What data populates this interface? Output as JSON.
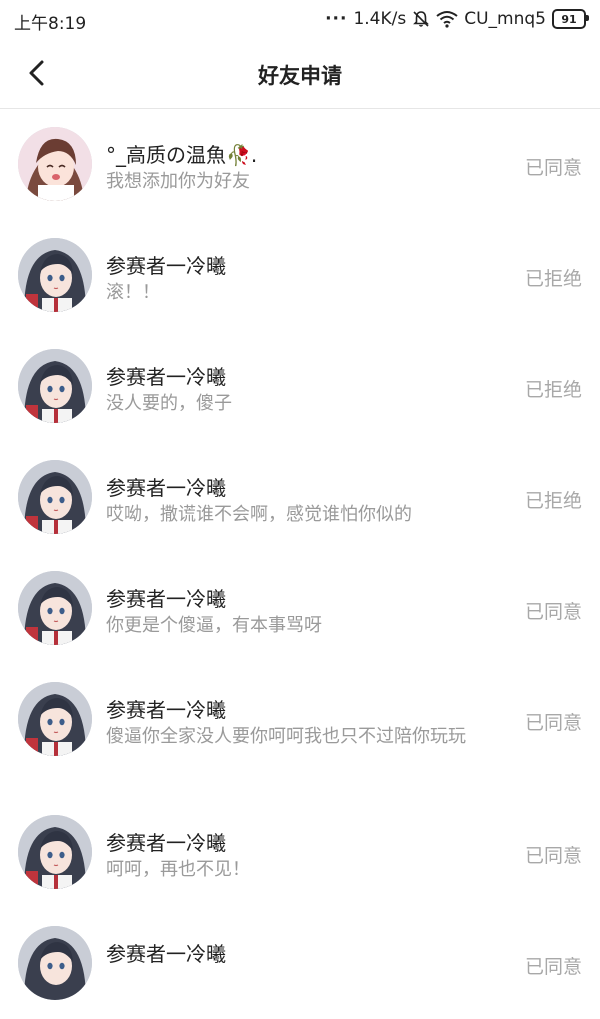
{
  "status_bar": {
    "time": "上午8:19",
    "net_speed": "1.4K/s",
    "carrier": "CU_mnq5",
    "battery": "91"
  },
  "nav": {
    "title": "好友申请"
  },
  "requests": [
    {
      "name": "°_高质の温魚🥀.",
      "message": "我想添加你为好友",
      "status": "已同意",
      "avatar": "girl-avatar-smiling"
    },
    {
      "name": "参赛者一冷曦",
      "message": "滚！！",
      "status": "已拒绝",
      "avatar": "girl-avatar-dark-hair"
    },
    {
      "name": "参赛者一冷曦",
      "message": "没人要的，傻子",
      "status": "已拒绝",
      "avatar": "girl-avatar-dark-hair"
    },
    {
      "name": "参赛者一冷曦",
      "message": "哎呦，撒谎谁不会啊，感觉谁怕你似的",
      "status": "已拒绝",
      "avatar": "girl-avatar-dark-hair"
    },
    {
      "name": "参赛者一冷曦",
      "message": "你更是个傻逼，有本事骂呀",
      "status": "已同意",
      "avatar": "girl-avatar-dark-hair"
    },
    {
      "name": "参赛者一冷曦",
      "message": "傻逼你全家没人要你呵呵我也只不过陪你玩玩",
      "status": "已同意",
      "avatar": "girl-avatar-dark-hair"
    },
    {
      "name": "参赛者一冷曦",
      "message": "呵呵，再也不见！",
      "status": "已同意",
      "avatar": "girl-avatar-dark-hair"
    },
    {
      "name": "参赛者一冷曦",
      "message": "",
      "status": "已同意",
      "avatar": "girl-avatar-dark-hair"
    }
  ]
}
